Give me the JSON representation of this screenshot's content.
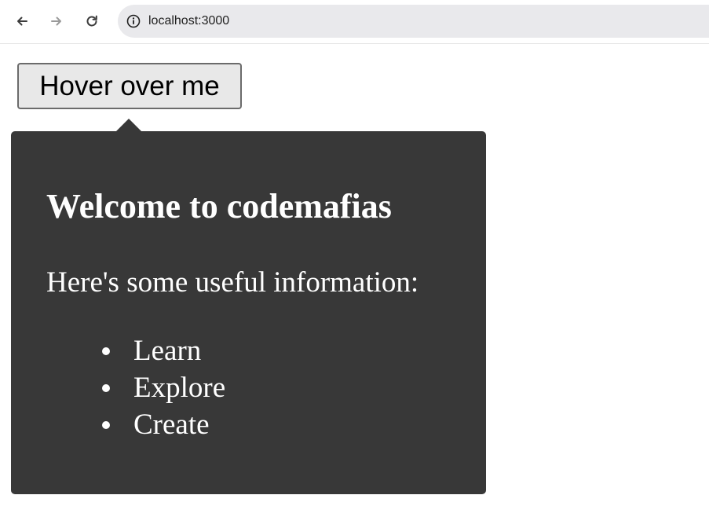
{
  "browser": {
    "url": "localhost:3000",
    "icons": {
      "back": "arrow-left-icon",
      "forward": "arrow-right-icon",
      "reload": "reload-icon",
      "site_info": "info-icon"
    }
  },
  "page": {
    "button_label": "Hover over me",
    "tooltip": {
      "heading": "Welcome to codemafias",
      "text": "Here's some useful information:",
      "items": [
        "Learn",
        "Explore",
        "Create"
      ]
    }
  },
  "colors": {
    "tooltip_background": "#383838",
    "tooltip_text": "#ffffff",
    "button_background": "#e8e8e8",
    "address_bar_background": "#e9e9ec"
  }
}
